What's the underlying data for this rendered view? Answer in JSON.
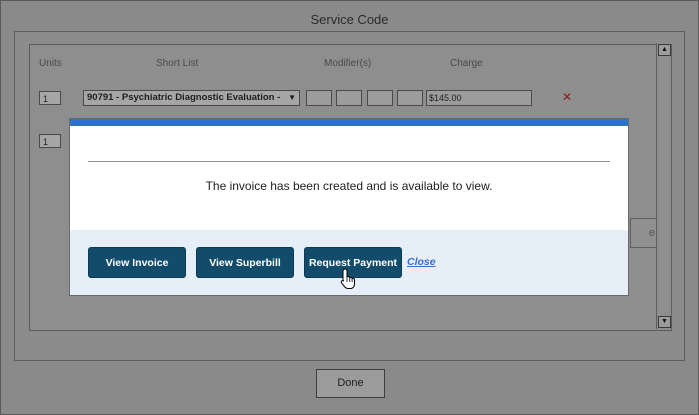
{
  "dialog": {
    "title": "Service Code",
    "done_label": "Done"
  },
  "table": {
    "headers": [
      "Units",
      "Short List",
      "Modifier(s)",
      "Charge"
    ],
    "rows": [
      {
        "units": "1",
        "service": "90791 - Psychiatric Diagnostic Evaluation -",
        "charge": "$145.00"
      },
      {
        "units": "1"
      }
    ],
    "remove_icon": "close-x-icon",
    "partial_button_label": "e"
  },
  "modal": {
    "message": "The invoice has been created and is available to view.",
    "buttons": {
      "view_invoice": "View Invoice",
      "view_superbill": "View Superbill",
      "request_payment": "Request Payment",
      "close": "Close"
    },
    "accent_color": "#2a73c5",
    "button_color": "#134c6b"
  },
  "cursor": "hand-pointer-icon"
}
